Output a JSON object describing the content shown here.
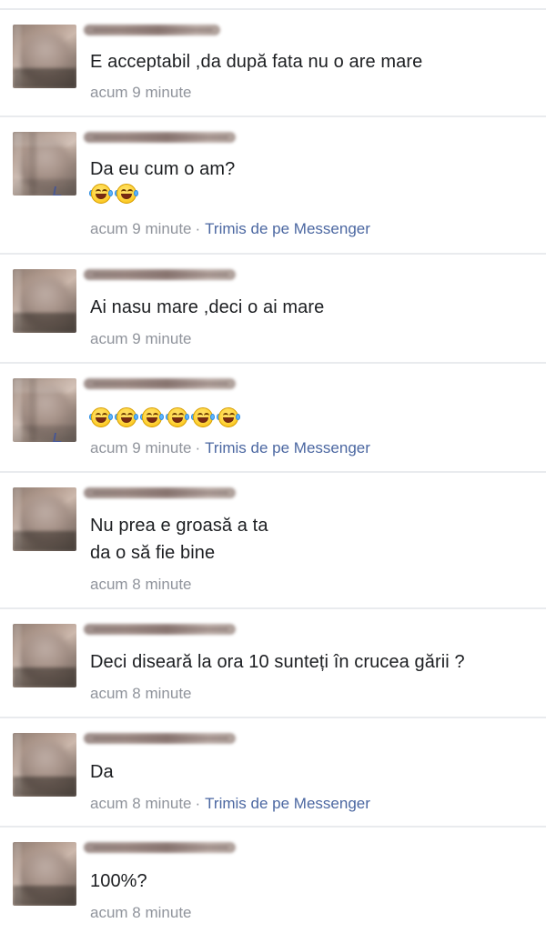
{
  "comments": [
    {
      "text": "E acceptabil ,da după fata nu o are mare",
      "emoji": [],
      "time": "acum 9 minute",
      "separator": "",
      "source": ""
    },
    {
      "text": "Da eu cum o am?",
      "emoji": [
        "tears-of-joy-icon",
        "tears-of-joy-icon"
      ],
      "time": "acum 9 minute",
      "separator": "·",
      "source": "Trimis de pe Messenger"
    },
    {
      "text": "Ai nasu mare ,deci o ai mare",
      "emoji": [],
      "time": "acum 9 minute",
      "separator": "",
      "source": ""
    },
    {
      "text": "",
      "emoji": [
        "tears-of-joy-icon",
        "tears-of-joy-icon",
        "tears-of-joy-icon",
        "tears-of-joy-icon",
        "tears-of-joy-icon",
        "tears-of-joy-icon"
      ],
      "time": "acum 9 minute",
      "separator": "·",
      "source": "Trimis de pe Messenger"
    },
    {
      "text": "Nu prea e groasă a ta\nda o să fie bine",
      "emoji": [],
      "time": "acum 8 minute",
      "separator": "",
      "source": ""
    },
    {
      "text": "Deci diseară la ora 10 sunteți în crucea gării ?",
      "emoji": [],
      "time": "acum 8 minute",
      "separator": "",
      "source": ""
    },
    {
      "text": "Da",
      "emoji": [],
      "time": "acum 8 minute",
      "separator": "·",
      "source": "Trimis de pe Messenger"
    },
    {
      "text": "100%?",
      "emoji": [],
      "time": "acum 8 minute",
      "separator": "",
      "source": ""
    }
  ],
  "colors": {
    "text": "#1c1e21",
    "meta": "#90949c",
    "messenger_link": "#4b67a1",
    "divider": "#e9ebee"
  }
}
